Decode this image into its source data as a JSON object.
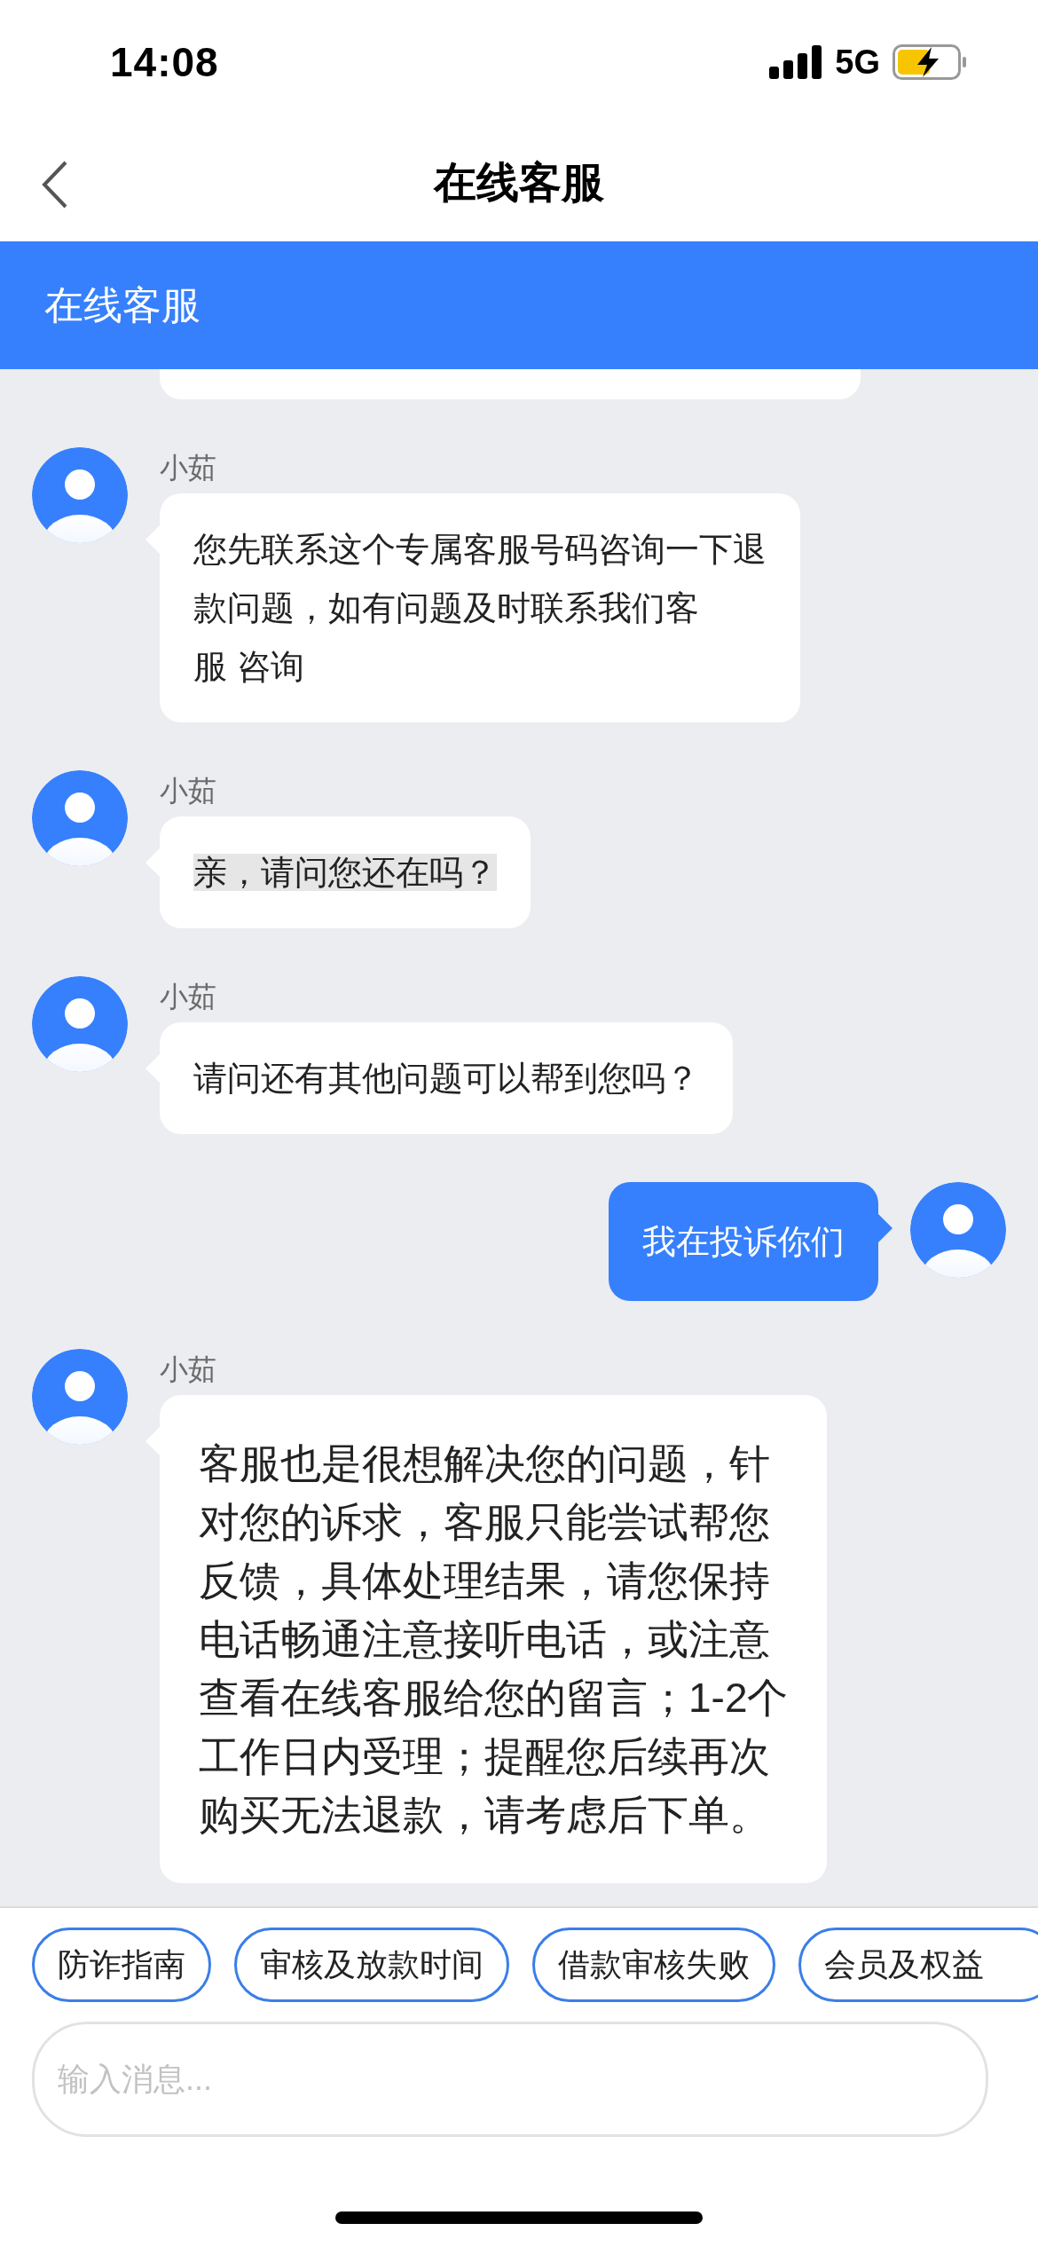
{
  "status_bar": {
    "time": "14:08",
    "network": "5G"
  },
  "nav_bar": {
    "title": "在线客服"
  },
  "header": {
    "title": "在线客服"
  },
  "messages": [
    {
      "kind": "partial"
    },
    {
      "kind": "agent",
      "name": "小茹",
      "lines": [
        "您先联系这个专属客服号码咨询一下退",
        "款问题，如有问题及时联系我们客",
        "服 咨询"
      ]
    },
    {
      "kind": "agent",
      "name": "小茹",
      "highlighted": true,
      "lines": [
        "亲，请问您还在吗？"
      ]
    },
    {
      "kind": "agent",
      "name": "小茹",
      "lines": [
        "请问还有其他问题可以帮到您吗？"
      ]
    },
    {
      "kind": "user",
      "lines": [
        "我在投诉你们"
      ]
    },
    {
      "kind": "agent",
      "name": "小茹",
      "lines": [
        "客服也是很想解决您的问题，针",
        "对您的诉求，客服只能尝试帮您",
        "反馈，具体处理结果，请您保持",
        "电话畅通注意接听电话，或注意",
        "查看在线客服给您的留言；1-2个",
        "工作日内受理；提醒您后续再次",
        "购买无法退款，请考虑后下单。"
      ]
    }
  ],
  "quick_replies": [
    "防诈指南",
    "审核及放款时间",
    "借款审核失败",
    "会员及权益"
  ],
  "input": {
    "placeholder": "输入消息..."
  }
}
